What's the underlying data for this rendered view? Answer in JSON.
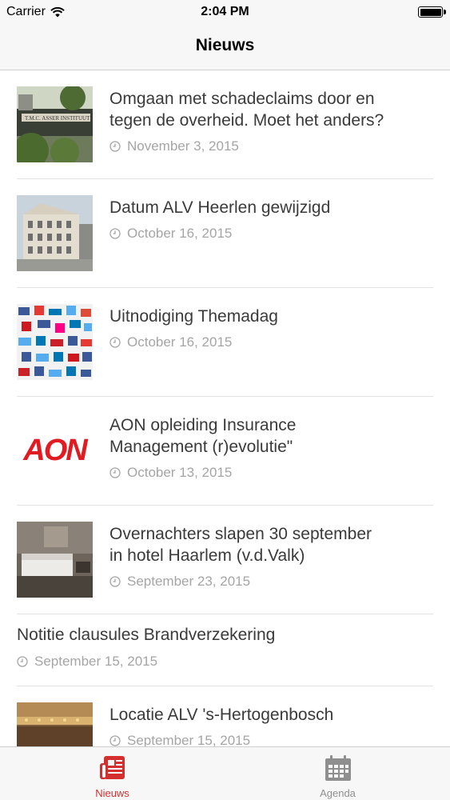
{
  "status_bar": {
    "carrier": "Carrier",
    "time": "2:04 PM"
  },
  "nav": {
    "title": "Nieuws"
  },
  "accent_color": "#d32f2f",
  "items": [
    {
      "title_lines": [
        "Omgaan met schadeclaims door en",
        "tegen de overheid. Moet het anders?"
      ],
      "date": "November 3, 2015",
      "image": "building-photo"
    },
    {
      "title_lines": [
        "Datum ALV Heerlen gewijzigd"
      ],
      "date": "October 16, 2015",
      "image": "building-photo"
    },
    {
      "title_lines": [
        "Uitnodiging Themadag"
      ],
      "date": "October 16, 2015",
      "image": "social-logos-photo"
    },
    {
      "title_lines": [
        "AON opleiding Insurance",
        "Management (r)evolutie\""
      ],
      "date": "October 13, 2015",
      "image": "aon-logo",
      "logo_text": "AON"
    },
    {
      "title_lines": [
        "Overnachters slapen 30 september",
        "in hotel Haarlem (v.d.Valk)"
      ],
      "date": "September 23, 2015",
      "image": "hotel-room-photo"
    },
    {
      "title_lines": [
        "Notitie clausules Brandverzekering"
      ],
      "date": "September 15, 2015",
      "image": null
    },
    {
      "title_lines": [
        "Locatie ALV 's-Hertogenbosch"
      ],
      "date": "September 15, 2015",
      "image": "hall-photo"
    }
  ],
  "tabs": [
    {
      "label": "Nieuws",
      "icon": "newspaper-icon",
      "active": true
    },
    {
      "label": "Agenda",
      "icon": "calendar-icon",
      "active": false
    }
  ]
}
